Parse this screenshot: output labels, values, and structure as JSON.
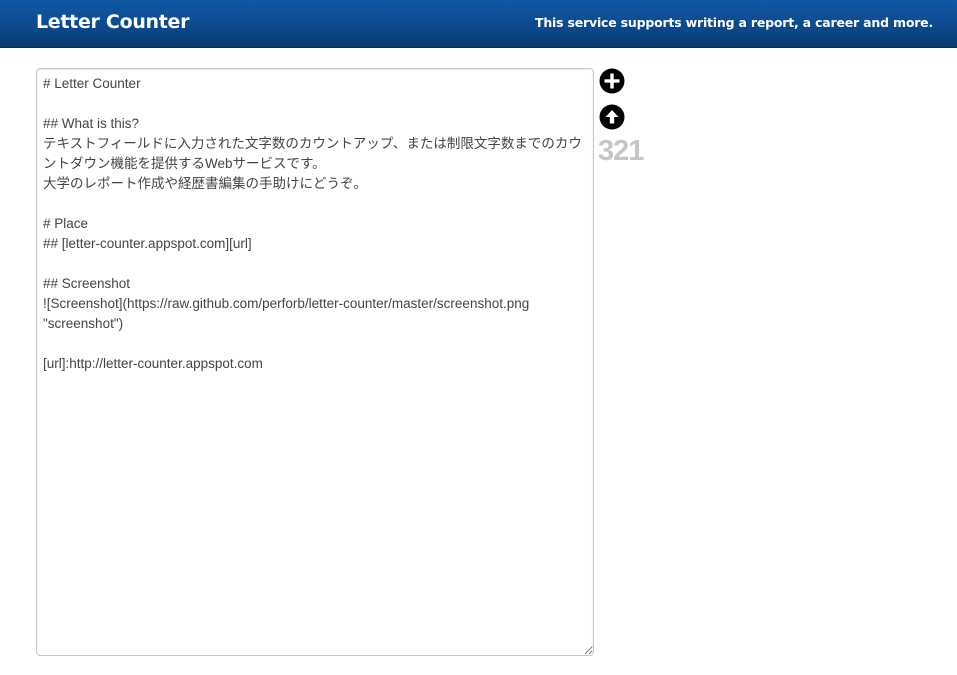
{
  "header": {
    "title": "Letter Counter",
    "tagline": "This service supports writing a report, a career and more."
  },
  "editor": {
    "content": "# Letter Counter\n\n## What is this?\nテキストフィールドに入力された文字数のカウントアップ、または制限文字数までのカウントダウン機能を提供するWebサービスです。\n大学のレポート作成や経歴書編集の手助けにどうぞ。\n\n# Place\n## [letter-counter.appspot.com][url]\n\n## Screenshot\n![Screenshot](https://raw.github.com/perforb/letter-counter/master/screenshot.png \"screenshot\")\n\n[url]:http://letter-counter.appspot.com"
  },
  "controls": {
    "add_icon": "plus-circle-icon",
    "up_icon": "arrow-up-circle-icon"
  },
  "counter": {
    "value": "321"
  },
  "colors": {
    "header_bg": "#0c4a8e",
    "counter_text": "#c6c6c6",
    "icon": "#000000"
  }
}
